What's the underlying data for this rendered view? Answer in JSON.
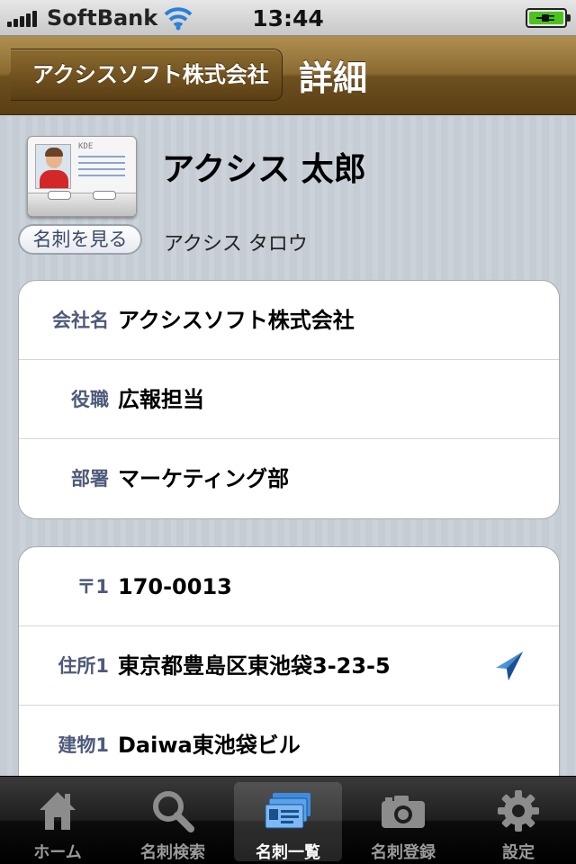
{
  "status_bar": {
    "carrier": "SoftBank",
    "time": "13:44",
    "signal_icon": "signal-bars-icon",
    "wifi_icon": "wifi-icon",
    "battery_icon": "battery-charging-icon",
    "battery_level": 1.0
  },
  "nav": {
    "back_label": "アクシスソフト株式会社",
    "title": "詳細"
  },
  "profile": {
    "card_icon": "business-card-icon",
    "card_thumb_text": "KDE",
    "view_card_label": "名刺を見る",
    "name": "アクシス 太郎",
    "name_kana": "アクシス タロウ"
  },
  "company_group": [
    {
      "label": "会社名",
      "value": "アクシスソフト株式会社"
    },
    {
      "label": "役職",
      "value": "広報担当"
    },
    {
      "label": "部署",
      "value": "マーケティング部"
    }
  ],
  "address_group": [
    {
      "label": "〒1",
      "value": "170-0013"
    },
    {
      "label": "住所1",
      "value": "東京都豊島区東池袋3-23-5",
      "icon": "location-arrow-icon"
    },
    {
      "label": "建物1",
      "value": "Daiwa東池袋ビル"
    }
  ],
  "tabbar": {
    "active_index": 2,
    "tabs": [
      {
        "label": "ホーム",
        "icon": "home-icon"
      },
      {
        "label": "名刺検索",
        "icon": "search-icon"
      },
      {
        "label": "名刺一覧",
        "icon": "card-list-icon"
      },
      {
        "label": "名刺登録",
        "icon": "camera-icon"
      },
      {
        "label": "設定",
        "icon": "gear-icon"
      }
    ]
  },
  "colors": {
    "nav_bar": "#7a5a26",
    "label_text": "#4e5a7a",
    "background": "#c5ccd4",
    "tab_bar": "#1a1a1a"
  }
}
